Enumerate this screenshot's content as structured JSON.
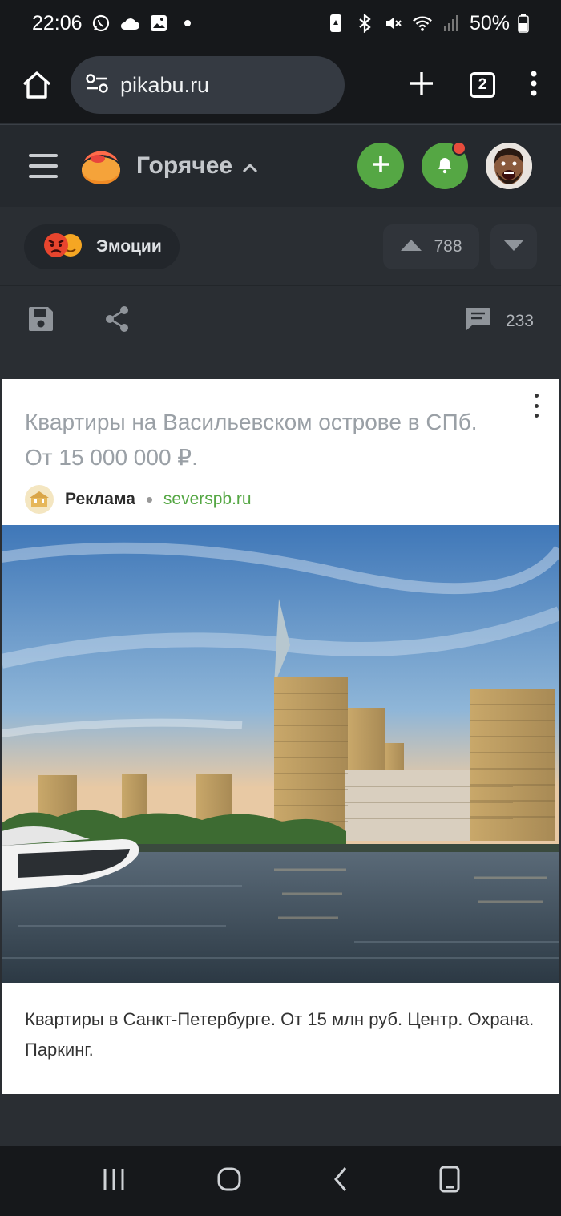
{
  "status_bar": {
    "time": "22:06",
    "battery": "50%"
  },
  "browser": {
    "url": "pikabu.ru",
    "tab_count": "2"
  },
  "header": {
    "section_title": "Горячее"
  },
  "post": {
    "tag_label": "Эмоции",
    "rating": "788",
    "comments_count": "233"
  },
  "ad": {
    "title": "Квартиры на Васильевском острове в СПб. От 15 000 000 ₽.",
    "label": "Реклама",
    "domain": "severspb.ru",
    "description": "Квартиры в Санкт-Петербурге. От 15 млн руб. Центр. Охрана. Паркинг."
  },
  "colors": {
    "accent": "#55a744",
    "notification": "#e74c3c",
    "background": "#2a2e33"
  },
  "icons": [
    "whatsapp-icon",
    "cloud-icon",
    "gallery-icon",
    "home-icon",
    "site-settings-icon",
    "new-tab-icon",
    "more-icon",
    "menu-icon",
    "pikabu-logo",
    "add-icon",
    "bell-icon",
    "save-icon",
    "share-icon",
    "comment-icon",
    "upvote-icon",
    "downvote-icon"
  ]
}
